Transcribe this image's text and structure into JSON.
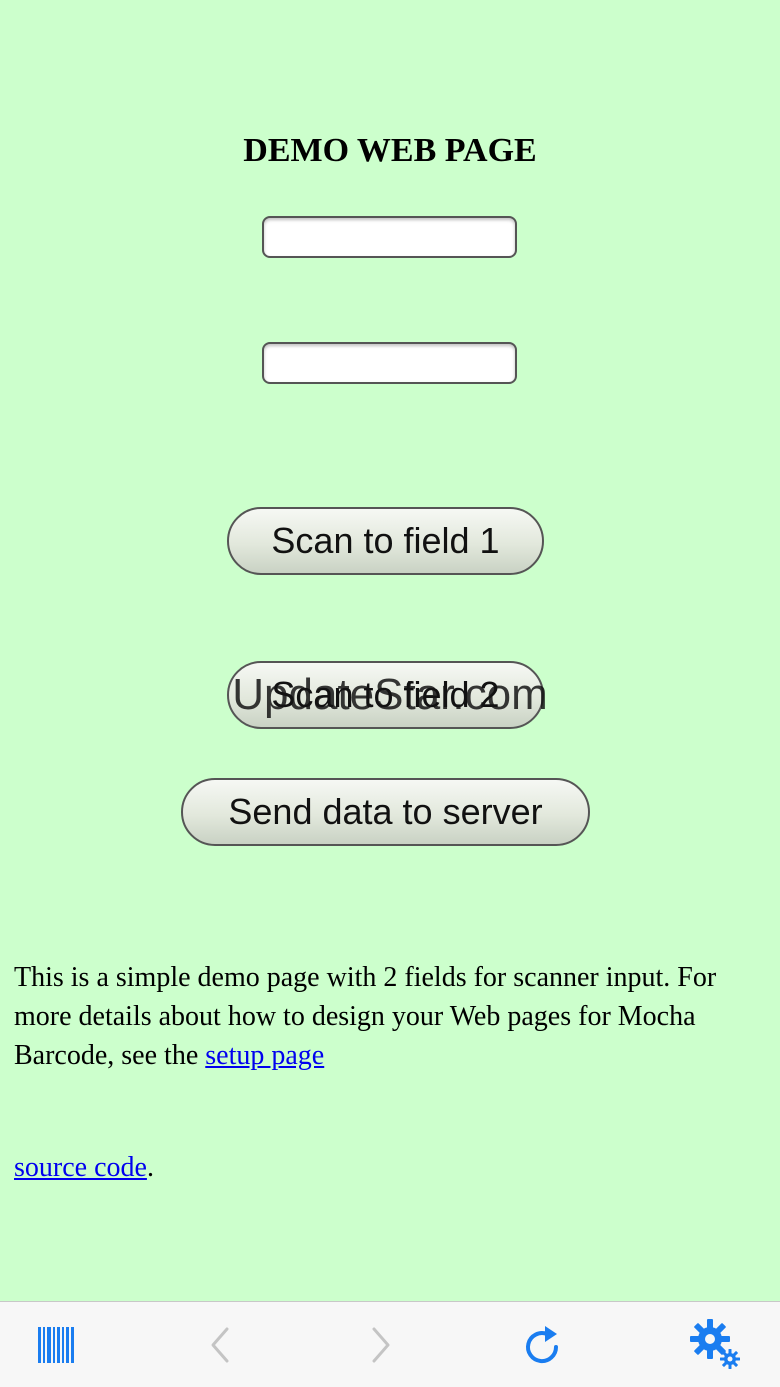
{
  "page": {
    "title": "DEMO WEB PAGE",
    "field1": {
      "value": "",
      "placeholder": ""
    },
    "field2": {
      "value": "",
      "placeholder": ""
    },
    "buttons": {
      "scan1": "Scan to field 1",
      "scan2": "Scan to field 2",
      "send": "Send data to server"
    },
    "watermark": "UpdateStar.com",
    "description": {
      "text": "This is a simple demo page with 2 fields for scanner input. For more details about how to design your Web pages for Mocha Barcode, see the ",
      "link": "setup page"
    },
    "source": {
      "link": "source code",
      "suffix": "."
    }
  },
  "toolbar": {
    "icons": [
      "barcode-icon",
      "back-arrow-icon",
      "forward-arrow-icon",
      "reload-icon",
      "settings-gear-icon"
    ],
    "colors": {
      "accent": "#1a7df0",
      "disabled": "#c4c4c4"
    }
  },
  "colors": {
    "background": "#ccffcc",
    "link": "#0000ee"
  }
}
